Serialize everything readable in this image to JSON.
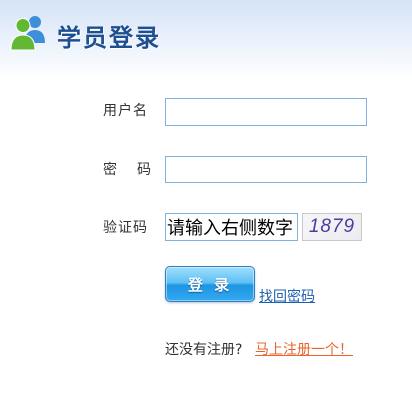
{
  "header": {
    "title": "学员登录",
    "icon": "user-group-icon"
  },
  "form": {
    "username": {
      "label": "用户名",
      "value": ""
    },
    "password": {
      "label": "密　码",
      "value": ""
    },
    "captcha": {
      "label": "验证码",
      "value": "请输入右侧数字",
      "code": "1879"
    },
    "submit_label": "登 录",
    "forgot_password": "找回密码"
  },
  "register": {
    "prompt": "还没有注册?",
    "link": "马上注册一个！"
  },
  "colors": {
    "title": "#1d4f91",
    "input_border": "#7fb3dd",
    "link": "#1f5fad",
    "register_link": "#e8652d",
    "captcha_text": "#4b3c9f",
    "button": "#1f95e3"
  }
}
